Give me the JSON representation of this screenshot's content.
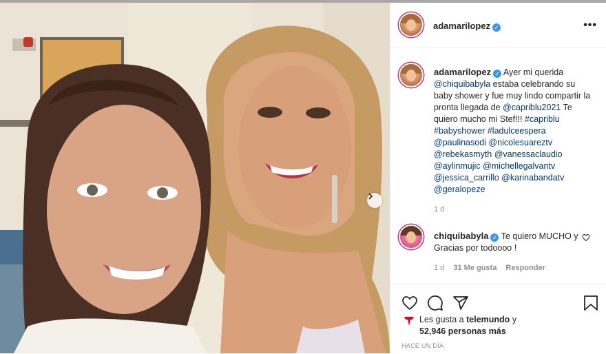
{
  "post": {
    "author": "adamarilopez",
    "caption_text_1": "Ayer mi querida",
    "caption_mention_1": "@chiquibabyla",
    "caption_text_2": "estaba celebrando su baby shower y fue muy lindo compartir la pronta llegada de",
    "caption_mention_2": "@capriblu2021",
    "caption_text_3": "Te quiero mucho mi Stef!!!",
    "hashtags": [
      "#capriblu",
      "#babyshower",
      "#ladulceespera"
    ],
    "mentions": [
      "@paulinasodi",
      "@nicolesuareztv",
      "@rebekasmyth",
      "@vanessaclaudio",
      "@aylinmujic",
      "@michellegalvantv",
      "@jessica_carrillo",
      "@karinabandatv",
      "@geralopeze"
    ],
    "caption_age": "1 d",
    "more_label": "•••"
  },
  "comment": {
    "author": "chiquibabyla",
    "text": "Te quiero MUCHO y Gracias por todoooo !",
    "age": "1 d",
    "likes": "31 Me gusta",
    "reply_label": "Responder"
  },
  "likes": {
    "prefix": "Les gusta a",
    "by": "telemundo",
    "and": "y",
    "count": "52,946 personas más"
  },
  "posted_ago": "HACE UN DÍA",
  "icons": [
    "heart-icon",
    "comment-icon",
    "share-icon",
    "bookmark-icon",
    "chevron-right-icon",
    "verified-icon",
    "telemundo-logo-icon"
  ],
  "colors": {
    "link": "#00376b",
    "verified": "#3897f0",
    "story_ring": "#c4367a",
    "telemundo_red": "#e3001b"
  }
}
